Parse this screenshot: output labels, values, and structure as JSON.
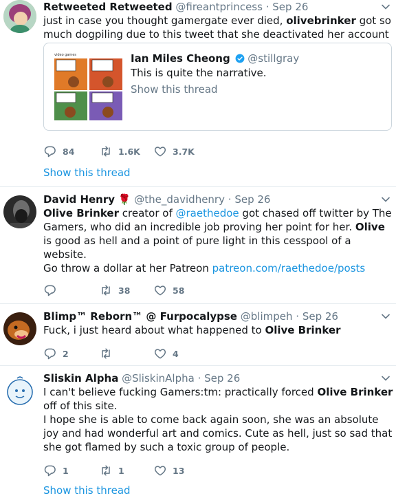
{
  "tweets": [
    {
      "retweet_label": "Retweeted Retweeted",
      "handle": "@fireantprincess",
      "sep": "·",
      "time": "Sep 26",
      "text_parts": [
        "just in case you thought gamergate ever died, ",
        "olivebrinker",
        " got so much dogpiling due to this tweet that she deactivated her account"
      ],
      "quote": {
        "panel_caption": "video games",
        "name": "Ian Miles Cheong",
        "handle": "@stillgray",
        "text": "This is quite the narrative.",
        "show_thread": "Show this thread"
      },
      "replies": "84",
      "retweets": "1.6K",
      "likes": "3.7K",
      "show_thread": "Show this thread"
    },
    {
      "name": "David Henry",
      "emoji": "🌹",
      "handle": "@the_davidhenry",
      "sep": "·",
      "time": "Sep 26",
      "line1": [
        "Olive Brinker",
        " creator of ",
        "@raethedoe",
        " got chased off twitter by The Gamers, who did an incredible job proving her point for her. ",
        "Olive",
        " is good as hell and a point of pure light in this cesspool of a website."
      ],
      "line2": [
        "Go throw a dollar at her Patreon ",
        "patreon.com/raethedoe/posts"
      ],
      "replies": "",
      "retweets": "38",
      "likes": "58"
    },
    {
      "name": "Blimp™ Reborn™ @ Furpocalypse",
      "handle": "@blimpeh",
      "sep": "·",
      "time": "Sep 26",
      "text_parts": [
        "Fuck, i just heard about what happened to ",
        "Olive Brinker"
      ],
      "replies": "2",
      "retweets": "",
      "likes": "4"
    },
    {
      "name": "Sliskin Alpha",
      "handle": "@SliskinAlpha",
      "sep": "·",
      "time": "Sep 26",
      "line1": [
        "I can't believe fucking Gamers:tm: practically forced ",
        "Olive Brinker",
        " off of this site."
      ],
      "line2": "I hope she is able to come back again soon, she was an absolute joy and had wonderful art and comics. Cute as hell, just so sad that she got flamed by such a toxic group of people.",
      "replies": "1",
      "retweets": "1",
      "likes": "13",
      "show_thread": "Show this thread"
    }
  ],
  "colors": {
    "link": "#1b95e0",
    "muted": "#657786",
    "text": "#14171a",
    "divider": "#e6ecf0"
  },
  "icons": [
    "reply-icon",
    "retweet-icon",
    "like-icon",
    "chevron-down-icon",
    "verified-icon"
  ]
}
